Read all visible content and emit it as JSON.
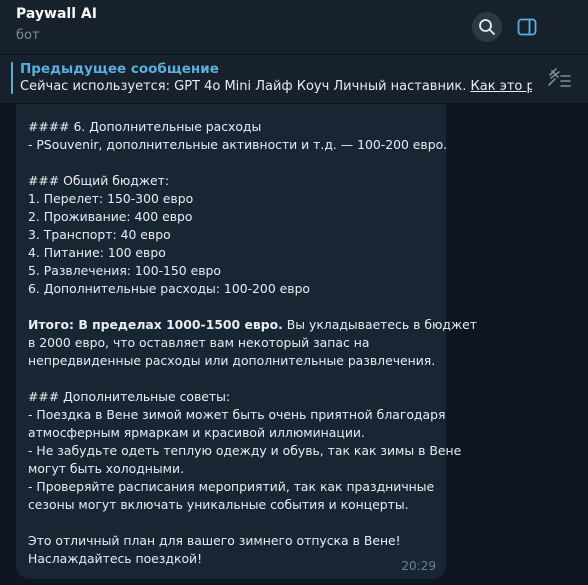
{
  "header": {
    "title": "Paywall AI",
    "subtitle": "бот",
    "search_icon": "search-icon",
    "panel_icon": "sidebar-toggle-icon"
  },
  "pinned": {
    "title": "Предыдущее сообщение",
    "text": "Сейчас используется: GPT 4o Mini Лайф Коуч Личный наставник. ",
    "link": "Как это работа...",
    "icon": "pin-list-icon"
  },
  "message": {
    "misc_heading": "#### 6. Дополнительные расходы",
    "misc_line": "- PSouvenir, дополнительные активности и т.д. — 100-200 евро.",
    "budget_heading": "### Общий бюджет:",
    "budget_items": [
      "1. Перелет: 150-300 евро",
      "2. Проживание: 400 евро",
      "3. Транспорт: 40 евро",
      "4. Питание: 100 евро",
      "5. Развлечения: 100-150 евро",
      "6. Дополнительные расходы: 100-200 евро"
    ],
    "total_bold": "Итого: В пределах 1000-1500 евро.",
    "total_rest_1": " Вы укладываетесь в бюджет",
    "total_rest_2": "в 2000 евро, что оставляет вам некоторый запас на",
    "total_rest_3": "непредвиденные расходы или дополнительные развлечения.",
    "tips_heading": "### Дополнительные советы:",
    "tips_lines": [
      "- Поездка в Вене зимой может быть очень приятной благодаря",
      "атмосферным ярмаркам и красивой иллюминации.",
      "- Не забудьте одеть теплую одежду и обувь, так как зимы в Вене",
      "могут быть холодными.",
      "- Проверяйте расписания мероприятий, так как праздничные",
      "сезоны могут включать уникальные события и концерты."
    ],
    "closing_1": "Это отличный план для вашего зимнего отпуска в Вене!",
    "closing_2": "Наслаждайтесь поездкой!",
    "time": "20:29"
  }
}
